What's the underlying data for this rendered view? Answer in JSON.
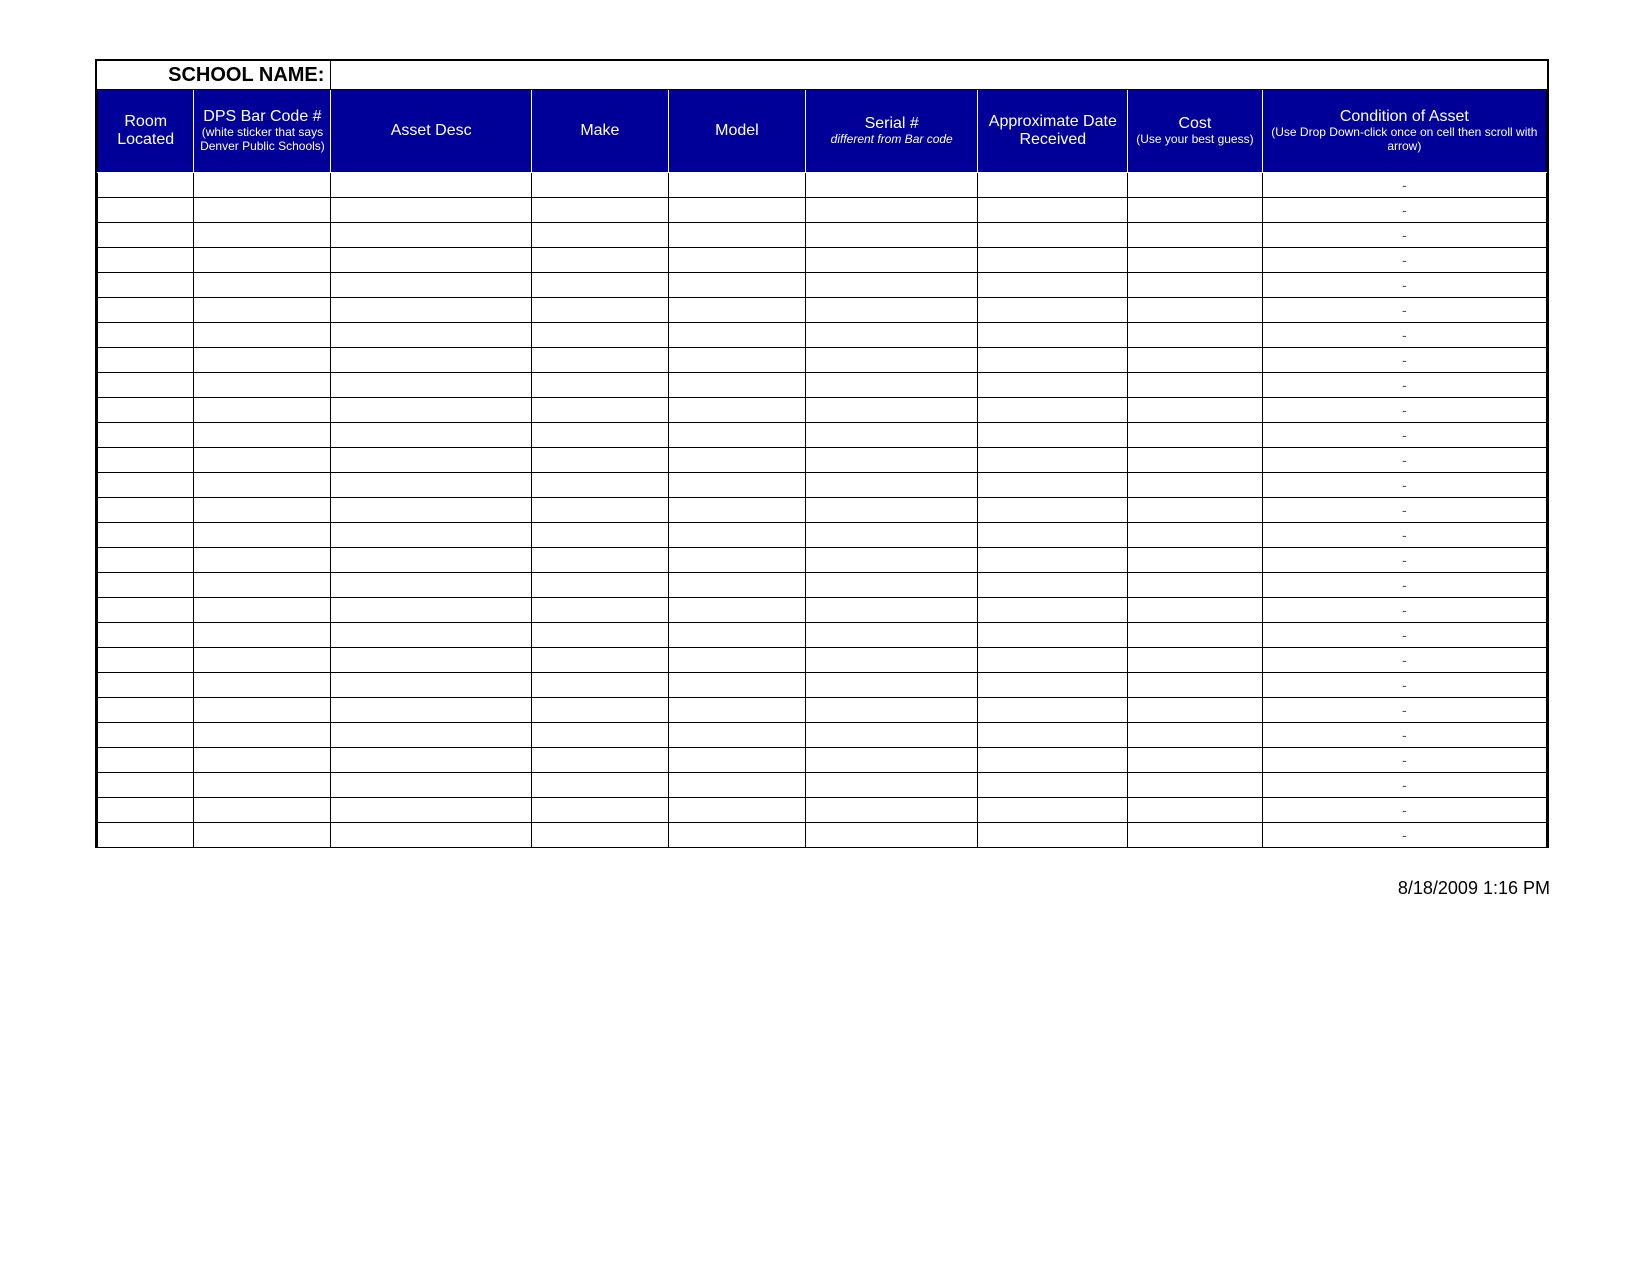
{
  "title_label": "SCHOOL NAME:",
  "title_value": "",
  "columns": [
    {
      "main": "Room Located",
      "sub": "",
      "italic": false,
      "class": "col-room"
    },
    {
      "main": "DPS Bar Code #",
      "sub": "(white sticker that says Denver Public Schools)",
      "italic": false,
      "class": "col-bar"
    },
    {
      "main": "Asset Desc",
      "sub": "",
      "italic": false,
      "class": "col-desc"
    },
    {
      "main": "Make",
      "sub": "",
      "italic": false,
      "class": "col-make"
    },
    {
      "main": "Model",
      "sub": "",
      "italic": false,
      "class": "col-model"
    },
    {
      "main": "Serial #",
      "sub": "different from Bar code",
      "italic": true,
      "class": "col-serial"
    },
    {
      "main": "Approximate Date Received",
      "sub": "",
      "italic": false,
      "class": "col-date"
    },
    {
      "main": "Cost",
      "sub": "(Use your best guess)",
      "italic": false,
      "class": "col-cost"
    },
    {
      "main": "Condition of Asset",
      "sub": "(Use Drop Down-click once on cell then scroll with arrow)",
      "italic": false,
      "class": "col-cond"
    }
  ],
  "rows": [
    [
      "",
      "",
      "",
      "",
      "",
      "",
      "",
      "",
      "-"
    ],
    [
      "",
      "",
      "",
      "",
      "",
      "",
      "",
      "",
      "-"
    ],
    [
      "",
      "",
      "",
      "",
      "",
      "",
      "",
      "",
      "-"
    ],
    [
      "",
      "",
      "",
      "",
      "",
      "",
      "",
      "",
      "-"
    ],
    [
      "",
      "",
      "",
      "",
      "",
      "",
      "",
      "",
      "-"
    ],
    [
      "",
      "",
      "",
      "",
      "",
      "",
      "",
      "",
      "-"
    ],
    [
      "",
      "",
      "",
      "",
      "",
      "",
      "",
      "",
      "-"
    ],
    [
      "",
      "",
      "",
      "",
      "",
      "",
      "",
      "",
      "-"
    ],
    [
      "",
      "",
      "",
      "",
      "",
      "",
      "",
      "",
      "-"
    ],
    [
      "",
      "",
      "",
      "",
      "",
      "",
      "",
      "",
      "-"
    ],
    [
      "",
      "",
      "",
      "",
      "",
      "",
      "",
      "",
      "-"
    ],
    [
      "",
      "",
      "",
      "",
      "",
      "",
      "",
      "",
      "-"
    ],
    [
      "",
      "",
      "",
      "",
      "",
      "",
      "",
      "",
      "-"
    ],
    [
      "",
      "",
      "",
      "",
      "",
      "",
      "",
      "",
      "-"
    ],
    [
      "",
      "",
      "",
      "",
      "",
      "",
      "",
      "",
      "-"
    ],
    [
      "",
      "",
      "",
      "",
      "",
      "",
      "",
      "",
      "-"
    ],
    [
      "",
      "",
      "",
      "",
      "",
      "",
      "",
      "",
      "-"
    ],
    [
      "",
      "",
      "",
      "",
      "",
      "",
      "",
      "",
      "-"
    ],
    [
      "",
      "",
      "",
      "",
      "",
      "",
      "",
      "",
      "-"
    ],
    [
      "",
      "",
      "",
      "",
      "",
      "",
      "",
      "",
      "-"
    ],
    [
      "",
      "",
      "",
      "",
      "",
      "",
      "",
      "",
      "-"
    ],
    [
      "",
      "",
      "",
      "",
      "",
      "",
      "",
      "",
      "-"
    ],
    [
      "",
      "",
      "",
      "",
      "",
      "",
      "",
      "",
      "-"
    ],
    [
      "",
      "",
      "",
      "",
      "",
      "",
      "",
      "",
      "-"
    ],
    [
      "",
      "",
      "",
      "",
      "",
      "",
      "",
      "",
      "-"
    ],
    [
      "",
      "",
      "",
      "",
      "",
      "",
      "",
      "",
      "-"
    ],
    [
      "",
      "",
      "",
      "",
      "",
      "",
      "",
      "",
      "-"
    ]
  ],
  "footer": "8/18/2009 1:16 PM"
}
